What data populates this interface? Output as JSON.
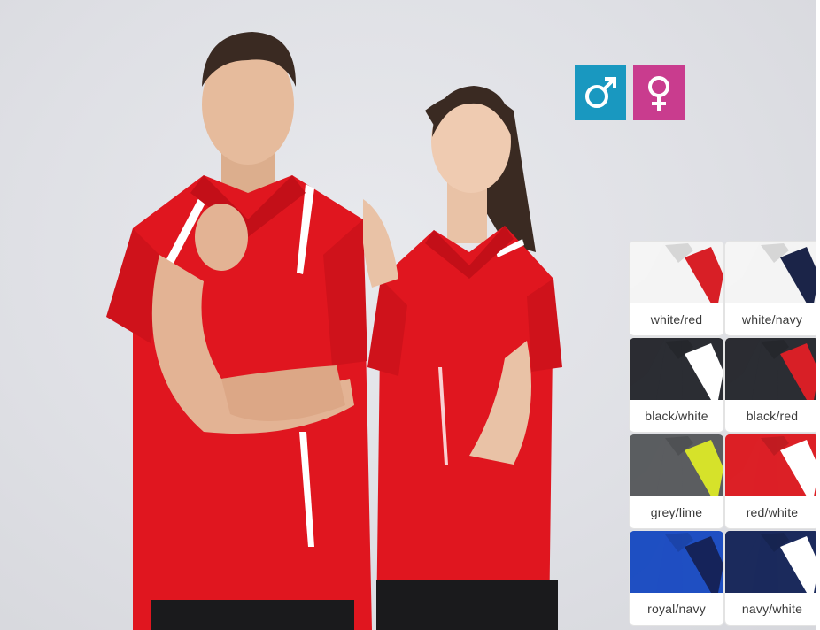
{
  "badges": {
    "male": {
      "icon": "male-symbol-icon",
      "color": "#1998c0"
    },
    "female": {
      "icon": "female-symbol-icon",
      "color": "#c93c8e"
    }
  },
  "swatches": [
    {
      "label": "white/red",
      "body": "#f4f4f4",
      "accent": "#d81f26"
    },
    {
      "label": "white/navy",
      "body": "#f4f4f4",
      "accent": "#1b2448"
    },
    {
      "label": "black/white",
      "body": "#2b2d33",
      "accent": "#ffffff"
    },
    {
      "label": "black/red",
      "body": "#2b2d33",
      "accent": "#d81f26"
    },
    {
      "label": "grey/lime",
      "body": "#5b5d60",
      "accent": "#d6e22a"
    },
    {
      "label": "red/white",
      "body": "#dc2026",
      "accent": "#ffffff"
    },
    {
      "label": "royal/navy",
      "body": "#1f4fc2",
      "accent": "#15235a"
    },
    {
      "label": "navy/white",
      "body": "#1b2a5c",
      "accent": "#ffffff"
    }
  ],
  "colors": {
    "shirt": "#e0161f",
    "shirt_shadow": "#b80f17",
    "skin": "#e9c2a6",
    "hair": "#3a2a22",
    "shorts": "#1a1a1c"
  }
}
